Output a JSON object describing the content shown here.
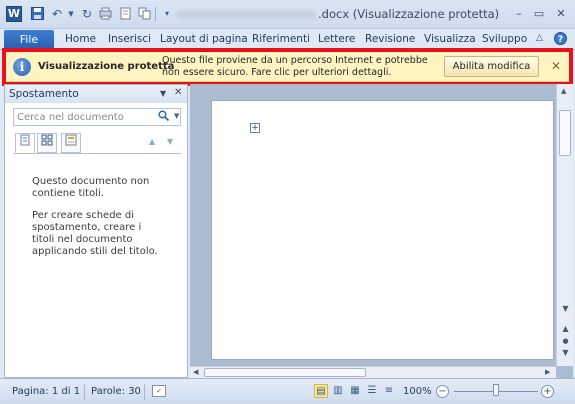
{
  "window": {
    "title_suffix": ".docx (Visualizzazione protetta)",
    "controls": {
      "minimize": "–",
      "restore": "▭",
      "close": "✕"
    }
  },
  "quick_access": {
    "app_icon": "W",
    "icons": [
      "save-icon",
      "undo-icon",
      "redo-icon",
      "print-icon",
      "page-icon",
      "copy-icon",
      "customize-icon"
    ]
  },
  "ribbon": {
    "file_tab": "File",
    "tabs": [
      "Home",
      "Inserisci",
      "Layout di pagina",
      "Riferimenti",
      "Lettere",
      "Revisione",
      "Visualizza",
      "Sviluppo"
    ]
  },
  "message_bar": {
    "title": "Visualizzazione protetta",
    "text": "Questo file proviene da un percorso Internet e potrebbe non essere sicuro. Fare clic per ulteriori dettagli.",
    "button_label": "Abilita modifica",
    "close": "✕",
    "highlight_color": "#e8101a",
    "background_color": "#fdf4c1"
  },
  "navigation_pane": {
    "title": "Spostamento",
    "search_placeholder": "Cerca nel documento",
    "no_headings": "Questo documento non contiene titoli.",
    "instructions": "Per creare schede di spostamento, creare i titoli nel documento applicando stili del titolo."
  },
  "statusbar": {
    "page": "Pagina: 1 di 1",
    "words": "Parole: 30",
    "zoom_level": "100%",
    "zoom_fraction": 0.5
  }
}
